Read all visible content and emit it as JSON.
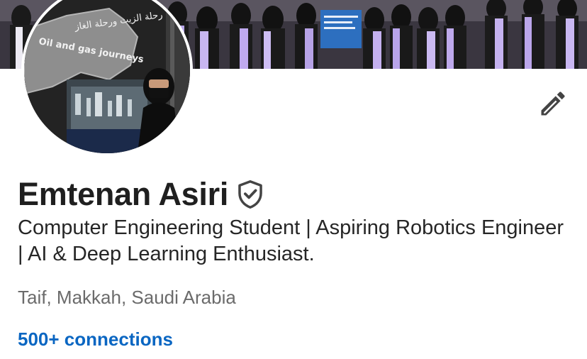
{
  "profile": {
    "name": "Emtenan Asiri",
    "headline": "Computer Engineering Student | Aspiring Robotics Engineer | AI & Deep Learning Enthusiast.",
    "location": "Taif, Makkah, Saudi Arabia",
    "connections": "500+ connections"
  },
  "avatar": {
    "sign_text_arabic": "رحلة الزيت ورحلة الغاز",
    "sign_text_english": "Oil and gas journeys"
  },
  "colors": {
    "link": "#0a66c2",
    "name": "#1f1f1f",
    "muted": "#6b6b6b",
    "icon": "#444444"
  },
  "icons": {
    "verify": "shield-check-icon",
    "edit": "pencil-icon"
  }
}
